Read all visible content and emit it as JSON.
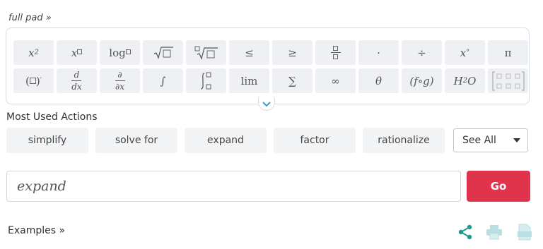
{
  "header": {
    "full_pad_link": "full pad »"
  },
  "keypad": {
    "row1": {
      "pow2": "2",
      "le": "≤",
      "ge": "≥",
      "cdot": "·",
      "div": "÷",
      "deg": "°",
      "pi": "π",
      "log": "log",
      "x": "x"
    },
    "row2": {
      "prime": "′",
      "d": "d",
      "dx": "dx",
      "partial": "∂",
      "partial_x": "∂x",
      "integral": "∫",
      "lim": "lim",
      "sum": "∑",
      "infinity": "∞",
      "theta": "θ",
      "compose": "(f∘g)",
      "h2o": "H",
      "h2o_sub": "2",
      "h2o_o": "O"
    }
  },
  "most_used": {
    "title": "Most Used Actions",
    "actions": [
      "simplify",
      "solve for",
      "expand",
      "factor",
      "rationalize"
    ],
    "see_all": "See All"
  },
  "query": {
    "value": "expand"
  },
  "go_label": "Go",
  "footer": {
    "examples_link": "Examples »"
  },
  "colors": {
    "accent_red": "#e0344d",
    "share_teal": "#1f9a8c",
    "tool_teal_light": "#b9dfe2"
  }
}
